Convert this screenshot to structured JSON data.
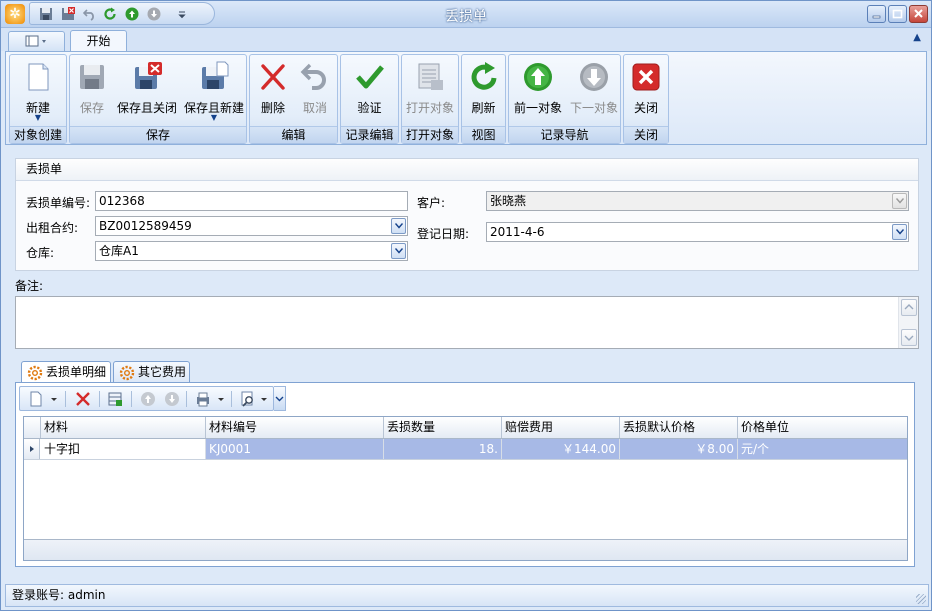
{
  "window": {
    "title": "丢损单"
  },
  "tabs": {
    "start": "开始"
  },
  "ribbon": {
    "groups": [
      {
        "label": "对象创建",
        "buttons": [
          "新建"
        ]
      },
      {
        "label": "保存",
        "buttons": [
          "保存",
          "保存且关闭",
          "保存且新建"
        ]
      },
      {
        "label": "编辑",
        "buttons": [
          "删除",
          "取消"
        ]
      },
      {
        "label": "记录编辑",
        "buttons": [
          "验证"
        ]
      },
      {
        "label": "打开对象",
        "buttons": [
          "打开对象"
        ]
      },
      {
        "label": "视图",
        "buttons": [
          "刷新"
        ]
      },
      {
        "label": "记录导航",
        "buttons": [
          "前一对象",
          "下一对象"
        ]
      },
      {
        "label": "关闭",
        "buttons": [
          "关闭"
        ]
      }
    ]
  },
  "form": {
    "panel_title": "丢损单",
    "number_label": "丢损单编号:",
    "number_value": "012368",
    "contract_label": "出租合约:",
    "contract_value": "BZ0012589459",
    "warehouse_label": "仓库:",
    "warehouse_value": "仓库A1",
    "customer_label": "客户:",
    "customer_value": "张晓燕",
    "date_label": "登记日期:",
    "date_value": "2011-4-6",
    "remarks_label": "备注:",
    "remarks_value": ""
  },
  "detail_tabs": [
    "丢损单明细",
    "其它费用"
  ],
  "grid": {
    "columns": [
      "材料",
      "材料编号",
      "丢损数量",
      "赔偿费用",
      "丢损默认价格",
      "价格单位"
    ],
    "rows": [
      {
        "material": "十字扣",
        "code": "KJ0001",
        "qty": "18.",
        "fee": "￥144.00",
        "price": "￥8.00",
        "unit": "元/个"
      }
    ]
  },
  "status": {
    "login": "登录账号: admin"
  },
  "colors": {
    "accent": "#15428b",
    "selection": "#a7b9e6",
    "delete": "#d42b2b",
    "ok": "#2e9a2e"
  }
}
